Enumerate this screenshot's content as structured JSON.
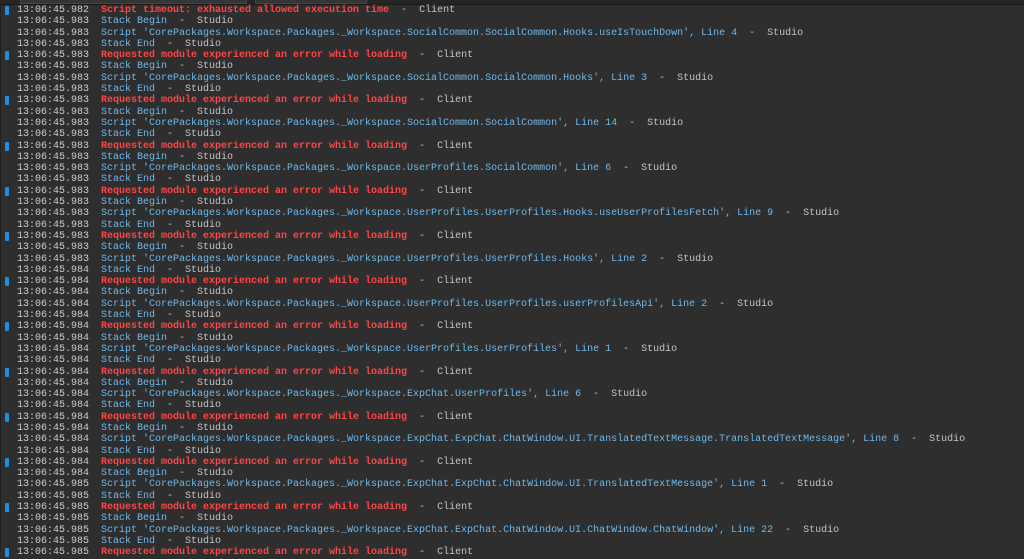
{
  "colors": {
    "background": "#2e2e2e",
    "info": "#6fb8ea",
    "error": "#ff4545",
    "timestamp": "#cccccc",
    "source": "#c4c4c4",
    "marker": "#1e8fe0"
  },
  "separator": "  -  ",
  "rows": [
    {
      "time": "13:06:45.982",
      "text": "Script timeout: exhausted allowed execution time",
      "source": "Client",
      "type": "error"
    },
    {
      "time": "13:06:45.983",
      "text": "Stack Begin",
      "source": "Studio",
      "type": "info"
    },
    {
      "time": "13:06:45.983",
      "text": "Script 'CorePackages.Workspace.Packages._Workspace.SocialCommon.SocialCommon.Hooks.useIsTouchDown', Line 4",
      "source": "Studio",
      "type": "info"
    },
    {
      "time": "13:06:45.983",
      "text": "Stack End",
      "source": "Studio",
      "type": "info"
    },
    {
      "time": "13:06:45.983",
      "text": "Requested module experienced an error while loading",
      "source": "Client",
      "type": "error"
    },
    {
      "time": "13:06:45.983",
      "text": "Stack Begin",
      "source": "Studio",
      "type": "info"
    },
    {
      "time": "13:06:45.983",
      "text": "Script 'CorePackages.Workspace.Packages._Workspace.SocialCommon.SocialCommon.Hooks', Line 3",
      "source": "Studio",
      "type": "info"
    },
    {
      "time": "13:06:45.983",
      "text": "Stack End",
      "source": "Studio",
      "type": "info"
    },
    {
      "time": "13:06:45.983",
      "text": "Requested module experienced an error while loading",
      "source": "Client",
      "type": "error"
    },
    {
      "time": "13:06:45.983",
      "text": "Stack Begin",
      "source": "Studio",
      "type": "info"
    },
    {
      "time": "13:06:45.983",
      "text": "Script 'CorePackages.Workspace.Packages._Workspace.SocialCommon.SocialCommon', Line 14",
      "source": "Studio",
      "type": "info"
    },
    {
      "time": "13:06:45.983",
      "text": "Stack End",
      "source": "Studio",
      "type": "info"
    },
    {
      "time": "13:06:45.983",
      "text": "Requested module experienced an error while loading",
      "source": "Client",
      "type": "error"
    },
    {
      "time": "13:06:45.983",
      "text": "Stack Begin",
      "source": "Studio",
      "type": "info"
    },
    {
      "time": "13:06:45.983",
      "text": "Script 'CorePackages.Workspace.Packages._Workspace.UserProfiles.SocialCommon', Line 6",
      "source": "Studio",
      "type": "info"
    },
    {
      "time": "13:06:45.983",
      "text": "Stack End",
      "source": "Studio",
      "type": "info"
    },
    {
      "time": "13:06:45.983",
      "text": "Requested module experienced an error while loading",
      "source": "Client",
      "type": "error"
    },
    {
      "time": "13:06:45.983",
      "text": "Stack Begin",
      "source": "Studio",
      "type": "info"
    },
    {
      "time": "13:06:45.983",
      "text": "Script 'CorePackages.Workspace.Packages._Workspace.UserProfiles.UserProfiles.Hooks.useUserProfilesFetch', Line 9",
      "source": "Studio",
      "type": "info"
    },
    {
      "time": "13:06:45.983",
      "text": "Stack End",
      "source": "Studio",
      "type": "info"
    },
    {
      "time": "13:06:45.983",
      "text": "Requested module experienced an error while loading",
      "source": "Client",
      "type": "error"
    },
    {
      "time": "13:06:45.983",
      "text": "Stack Begin",
      "source": "Studio",
      "type": "info"
    },
    {
      "time": "13:06:45.983",
      "text": "Script 'CorePackages.Workspace.Packages._Workspace.UserProfiles.UserProfiles.Hooks', Line 2",
      "source": "Studio",
      "type": "info"
    },
    {
      "time": "13:06:45.984",
      "text": "Stack End",
      "source": "Studio",
      "type": "info"
    },
    {
      "time": "13:06:45.984",
      "text": "Requested module experienced an error while loading",
      "source": "Client",
      "type": "error"
    },
    {
      "time": "13:06:45.984",
      "text": "Stack Begin",
      "source": "Studio",
      "type": "info"
    },
    {
      "time": "13:06:45.984",
      "text": "Script 'CorePackages.Workspace.Packages._Workspace.UserProfiles.UserProfiles.userProfilesApi', Line 2",
      "source": "Studio",
      "type": "info"
    },
    {
      "time": "13:06:45.984",
      "text": "Stack End",
      "source": "Studio",
      "type": "info"
    },
    {
      "time": "13:06:45.984",
      "text": "Requested module experienced an error while loading",
      "source": "Client",
      "type": "error"
    },
    {
      "time": "13:06:45.984",
      "text": "Stack Begin",
      "source": "Studio",
      "type": "info"
    },
    {
      "time": "13:06:45.984",
      "text": "Script 'CorePackages.Workspace.Packages._Workspace.UserProfiles.UserProfiles', Line 1",
      "source": "Studio",
      "type": "info"
    },
    {
      "time": "13:06:45.984",
      "text": "Stack End",
      "source": "Studio",
      "type": "info"
    },
    {
      "time": "13:06:45.984",
      "text": "Requested module experienced an error while loading",
      "source": "Client",
      "type": "error"
    },
    {
      "time": "13:06:45.984",
      "text": "Stack Begin",
      "source": "Studio",
      "type": "info"
    },
    {
      "time": "13:06:45.984",
      "text": "Script 'CorePackages.Workspace.Packages._Workspace.ExpChat.UserProfiles', Line 6",
      "source": "Studio",
      "type": "info"
    },
    {
      "time": "13:06:45.984",
      "text": "Stack End",
      "source": "Studio",
      "type": "info"
    },
    {
      "time": "13:06:45.984",
      "text": "Requested module experienced an error while loading",
      "source": "Client",
      "type": "error"
    },
    {
      "time": "13:06:45.984",
      "text": "Stack Begin",
      "source": "Studio",
      "type": "info"
    },
    {
      "time": "13:06:45.984",
      "text": "Script 'CorePackages.Workspace.Packages._Workspace.ExpChat.ExpChat.ChatWindow.UI.TranslatedTextMessage.TranslatedTextMessage', Line 8",
      "source": "Studio",
      "type": "info"
    },
    {
      "time": "13:06:45.984",
      "text": "Stack End",
      "source": "Studio",
      "type": "info"
    },
    {
      "time": "13:06:45.984",
      "text": "Requested module experienced an error while loading",
      "source": "Client",
      "type": "error"
    },
    {
      "time": "13:06:45.984",
      "text": "Stack Begin",
      "source": "Studio",
      "type": "info"
    },
    {
      "time": "13:06:45.985",
      "text": "Script 'CorePackages.Workspace.Packages._Workspace.ExpChat.ExpChat.ChatWindow.UI.TranslatedTextMessage', Line 1",
      "source": "Studio",
      "type": "info"
    },
    {
      "time": "13:06:45.985",
      "text": "Stack End",
      "source": "Studio",
      "type": "info"
    },
    {
      "time": "13:06:45.985",
      "text": "Requested module experienced an error while loading",
      "source": "Client",
      "type": "error"
    },
    {
      "time": "13:06:45.985",
      "text": "Stack Begin",
      "source": "Studio",
      "type": "info"
    },
    {
      "time": "13:06:45.985",
      "text": "Script 'CorePackages.Workspace.Packages._Workspace.ExpChat.ExpChat.ChatWindow.UI.ChatWindow.ChatWindow', Line 22",
      "source": "Studio",
      "type": "info"
    },
    {
      "time": "13:06:45.985",
      "text": "Stack End",
      "source": "Studio",
      "type": "info"
    },
    {
      "time": "13:06:45.985",
      "text": "Requested module experienced an error while loading",
      "source": "Client",
      "type": "error"
    }
  ]
}
